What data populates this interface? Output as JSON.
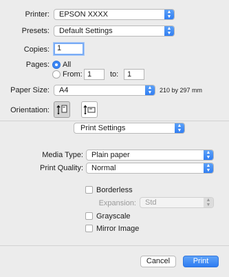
{
  "printer": {
    "label": "Printer:",
    "value": "EPSON XXXX"
  },
  "presets": {
    "label": "Presets:",
    "value": "Default Settings"
  },
  "copies": {
    "label": "Copies:",
    "value": "1"
  },
  "pages": {
    "label": "Pages:",
    "all_label": "All",
    "from_label": "From:",
    "from_value": "1",
    "to_label": "to:",
    "to_value": "1"
  },
  "paper_size": {
    "label": "Paper Size:",
    "value": "A4",
    "dimensions": "210 by 297 mm"
  },
  "orientation": {
    "label": "Orientation:",
    "selected": "portrait"
  },
  "section": {
    "value": "Print Settings"
  },
  "media_type": {
    "label": "Media Type:",
    "value": "Plain paper"
  },
  "print_quality": {
    "label": "Print Quality:",
    "value": "Normal"
  },
  "borderless": {
    "label": "Borderless",
    "checked": false
  },
  "expansion": {
    "label": "Expansion:",
    "value": "Std",
    "enabled": false
  },
  "grayscale": {
    "label": "Grayscale",
    "checked": false
  },
  "mirror_image": {
    "label": "Mirror Image",
    "checked": false
  },
  "buttons": {
    "cancel": "Cancel",
    "print": "Print"
  },
  "colors": {
    "accent": "#3b86f5",
    "background": "#ececec"
  }
}
